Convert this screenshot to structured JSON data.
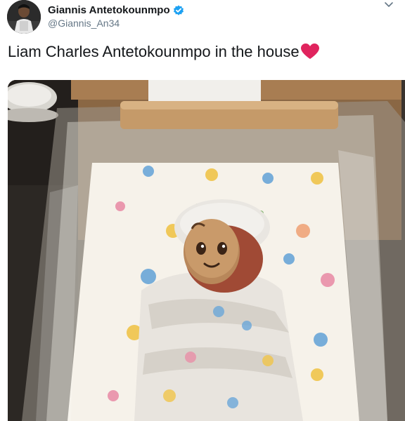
{
  "author": {
    "display_name": "Giannis Antetokounmpo",
    "handle": "@Giannis_An34",
    "verified": true,
    "avatar_icon": "profile-photo"
  },
  "tweet": {
    "text": "Liam Charles Antetokounmpo in the house",
    "emoji": "red-heart-icon"
  },
  "media": {
    "description_icon": "photo",
    "emoji_overlay": "face-emoji"
  },
  "colors": {
    "text": "#14171a",
    "secondary": "#657786",
    "verified": "#1da1f2",
    "heart": "#e0245e"
  }
}
